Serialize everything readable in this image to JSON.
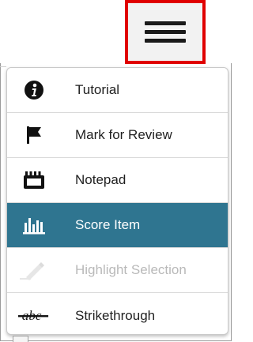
{
  "toolbar": {
    "menu_button_icon": "hamburger-menu-icon"
  },
  "menu": {
    "items": [
      {
        "label": "Tutorial",
        "icon": "info-circle-icon",
        "state": "normal"
      },
      {
        "label": "Mark for Review",
        "icon": "flag-icon",
        "state": "normal"
      },
      {
        "label": "Notepad",
        "icon": "notepad-icon",
        "state": "normal"
      },
      {
        "label": "Score Item",
        "icon": "bar-chart-icon",
        "state": "selected"
      },
      {
        "label": "Highlight Selection",
        "icon": "highlighter-icon",
        "state": "disabled"
      },
      {
        "label": "Strikethrough",
        "icon": "strikethrough-abc-icon",
        "state": "normal"
      }
    ]
  },
  "colors": {
    "selected_background": "#2f7590",
    "highlight_outline": "#e00000",
    "disabled_text": "#b9b9b9"
  }
}
